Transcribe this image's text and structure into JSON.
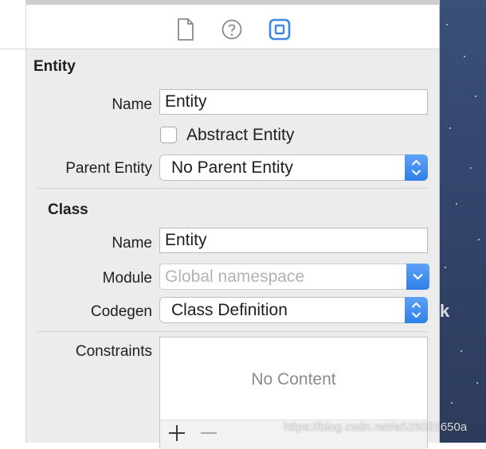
{
  "toolbar": {
    "icons": [
      "file-inspector-icon",
      "quick-help-icon",
      "data-model-inspector-icon"
    ],
    "active": "data-model-inspector-icon",
    "accent": "#3b86e0"
  },
  "entity": {
    "section_title": "Entity",
    "name_label": "Name",
    "name_value": "Entity",
    "abstract_label": "Abstract Entity",
    "abstract_checked": false,
    "parent_label": "Parent Entity",
    "parent_value": "No Parent Entity"
  },
  "class": {
    "section_title": "Class",
    "name_label": "Name",
    "name_value": "Entity",
    "module_label": "Module",
    "module_placeholder": "Global namespace",
    "codegen_label": "Codegen",
    "codegen_value": "Class Definition"
  },
  "constraints": {
    "label": "Constraints",
    "empty_text": "No Content"
  },
  "desktop": {
    "partial_text": "k"
  },
  "watermark": "https://blog.csdn.net/a526001650a"
}
